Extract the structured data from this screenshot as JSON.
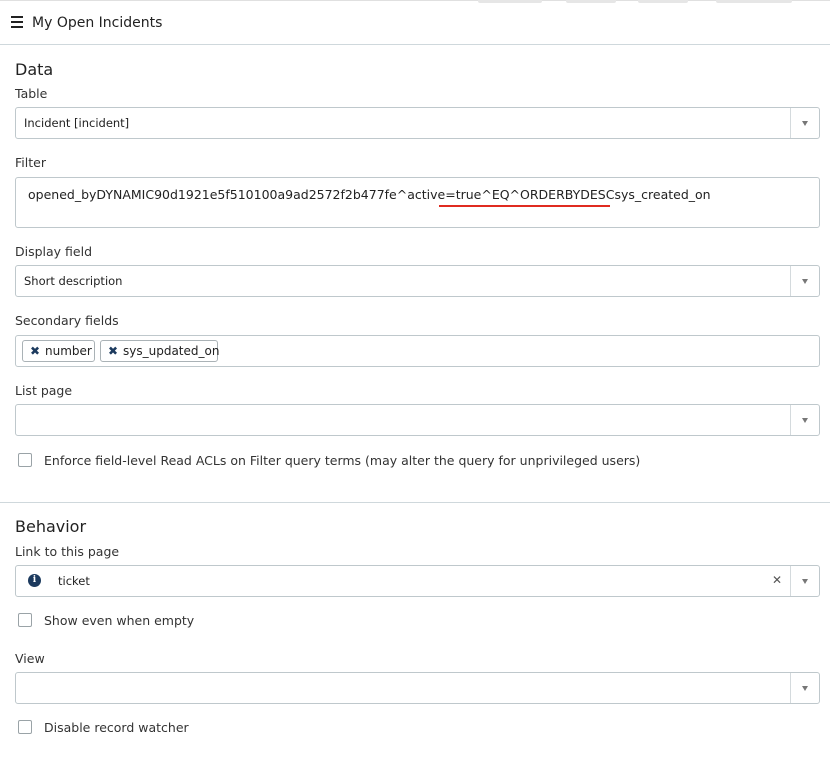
{
  "header": {
    "title": "My Open Incidents"
  },
  "data_section": {
    "title": "Data",
    "table": {
      "label": "Table",
      "value": "Incident [incident]"
    },
    "filter": {
      "label": "Filter",
      "value": "opened_byDYNAMIC90d1921e5f510100a9ad2572f2b477fe^active=true^EQ^ORDERBYDESCsys_created_on"
    },
    "display_field": {
      "label": "Display field",
      "value": "Short description"
    },
    "secondary_fields": {
      "label": "Secondary fields",
      "tags": [
        "number",
        "sys_updated_on"
      ]
    },
    "list_page": {
      "label": "List page",
      "value": ""
    },
    "enforce_acl": {
      "label": "Enforce field-level Read ACLs on Filter query terms (may alter the query for unprivileged users)",
      "checked": false
    }
  },
  "behavior_section": {
    "title": "Behavior",
    "link_to_page": {
      "label": "Link to this page",
      "value": "ticket"
    },
    "show_even_when_empty": {
      "label": "Show even when empty",
      "checked": false
    },
    "view": {
      "label": "View",
      "value": ""
    },
    "disable_record_watcher": {
      "label": "Disable record watcher",
      "checked": false
    }
  },
  "icons": {
    "menu": "hamburger-icon",
    "dropdown": "chevron-down-icon",
    "tag_remove": "close-icon",
    "info": "info-icon",
    "clear": "close-icon"
  },
  "colors": {
    "annotation_underline": "#e02b20",
    "icon_dark": "#1c3a5e",
    "border": "#bfc8cc"
  }
}
